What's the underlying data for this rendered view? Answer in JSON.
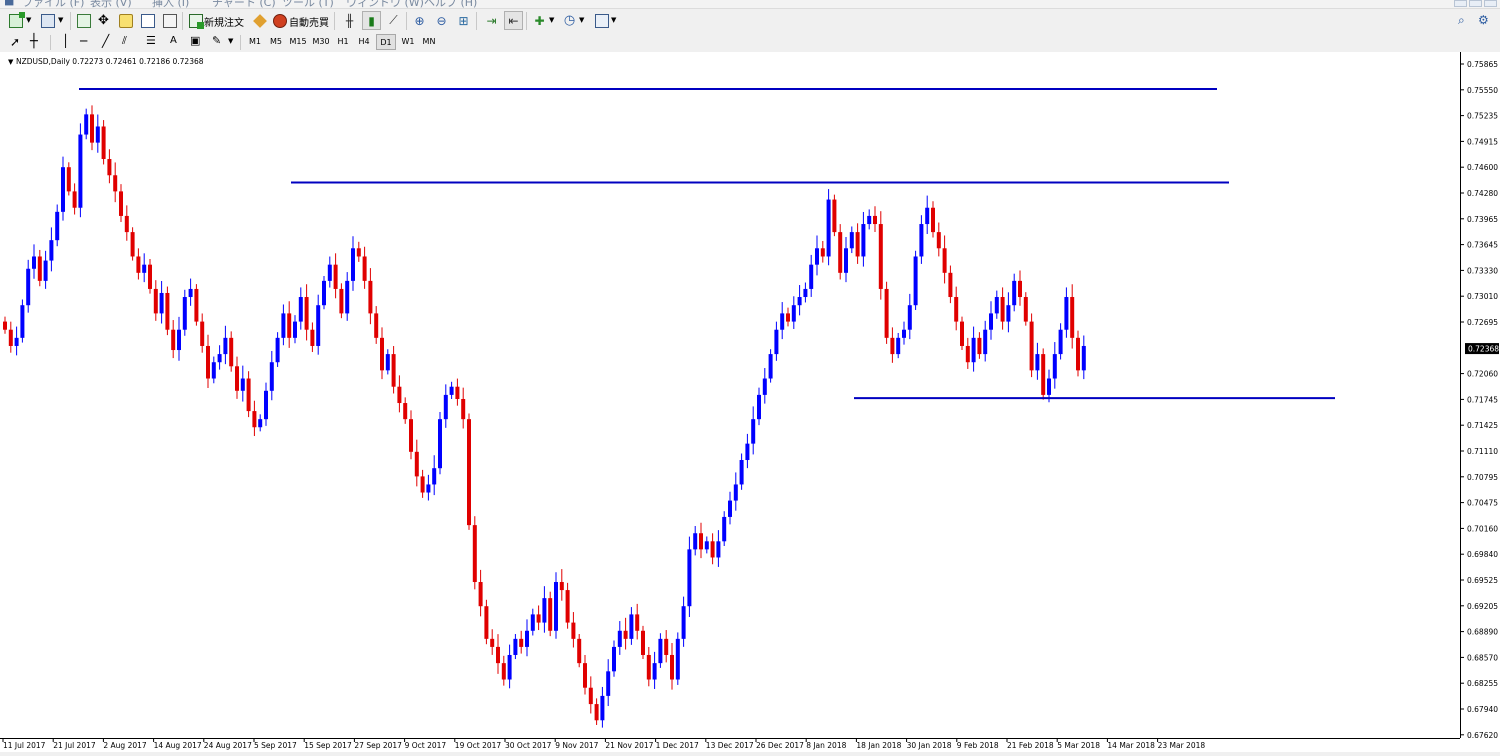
{
  "menu": [
    "ファイル (F)",
    "表示 (V)",
    "挿入 (I)",
    "チャート (C)",
    "ツール (T)",
    "ウィンドウ (W)",
    "ヘルプ (H)"
  ],
  "toolbar": {
    "new_order_label": "新規注文",
    "auto_trading_label": "自動売買"
  },
  "timeframes": [
    "M1",
    "M5",
    "M15",
    "M30",
    "H1",
    "H4",
    "D1",
    "W1",
    "MN"
  ],
  "active_timeframe": "D1",
  "chart": {
    "header": "NZDUSD,Daily  0.72273 0.72461 0.72186 0.72368",
    "current_price_label": "0.72368"
  },
  "colors": {
    "bull": "#0000ff",
    "bear": "#e00000",
    "line": "#0000c0",
    "price_tag": "#000000"
  },
  "chart_data": {
    "type": "candlestick",
    "symbol": "NZDUSD",
    "period": "Daily",
    "ohlc_last": {
      "open": 0.72273,
      "high": 0.72461,
      "low": 0.72186,
      "close": 0.72368
    },
    "y_ticks": [
      "0.75865",
      "0.75550",
      "0.75235",
      "0.74915",
      "0.74600",
      "0.74280",
      "0.73965",
      "0.73645",
      "0.73330",
      "0.73010",
      "0.72695",
      "0.72060",
      "0.71745",
      "0.71425",
      "0.71110",
      "0.70795",
      "0.70475",
      "0.70160",
      "0.69840",
      "0.69525",
      "0.69205",
      "0.68890",
      "0.68570",
      "0.68255",
      "0.67940",
      "0.67620"
    ],
    "x_ticks": [
      "11 Jul 2017",
      "21 Jul 2017",
      "2 Aug 2017",
      "14 Aug 2017",
      "24 Aug 2017",
      "5 Sep 2017",
      "15 Sep 2017",
      "27 Sep 2017",
      "9 Oct 2017",
      "19 Oct 2017",
      "30 Oct 2017",
      "9 Nov 2017",
      "21 Nov 2017",
      "1 Dec 2017",
      "13 Dec 2017",
      "26 Dec 2017",
      "8 Jan 2018",
      "18 Jan 2018",
      "30 Jan 2018",
      "9 Feb 2018",
      "21 Feb 2018",
      "5 Mar 2018",
      "14 Mar 2018",
      "23 Mar 2018"
    ],
    "ylim": [
      0.675,
      0.76
    ],
    "horizontal_lines": [
      {
        "price": 0.7556,
        "from": "21 Jul 2017",
        "to": "late Apr 2018"
      },
      {
        "price": 0.7441,
        "from": "early Sep 2017",
        "to": "late Apr 2018"
      },
      {
        "price": 0.7176,
        "from": "12 Jan 2018",
        "to": "mid May 2018"
      }
    ],
    "closes": [
      0.726,
      0.724,
      0.725,
      0.729,
      0.7335,
      0.735,
      0.732,
      0.7345,
      0.737,
      0.7405,
      0.746,
      0.743,
      0.741,
      0.75,
      0.7525,
      0.749,
      0.751,
      0.747,
      0.745,
      0.743,
      0.74,
      0.738,
      0.735,
      0.733,
      0.734,
      0.731,
      0.728,
      0.7305,
      0.726,
      0.7235,
      0.726,
      0.73,
      0.731,
      0.727,
      0.724,
      0.72,
      0.722,
      0.723,
      0.725,
      0.7215,
      0.7185,
      0.72,
      0.716,
      0.714,
      0.715,
      0.7185,
      0.722,
      0.725,
      0.728,
      0.725,
      0.727,
      0.73,
      0.726,
      0.724,
      0.729,
      0.732,
      0.734,
      0.731,
      0.728,
      0.732,
      0.736,
      0.735,
      0.732,
      0.728,
      0.725,
      0.721,
      0.723,
      0.719,
      0.717,
      0.715,
      0.711,
      0.708,
      0.706,
      0.707,
      0.709,
      0.715,
      0.718,
      0.719,
      0.7175,
      0.715,
      0.702,
      0.695,
      0.692,
      0.688,
      0.687,
      0.685,
      0.683,
      0.686,
      0.688,
      0.687,
      0.689,
      0.691,
      0.69,
      0.693,
      0.689,
      0.695,
      0.694,
      0.69,
      0.688,
      0.685,
      0.682,
      0.68,
      0.678,
      0.681,
      0.684,
      0.687,
      0.689,
      0.688,
      0.691,
      0.689,
      0.686,
      0.683,
      0.685,
      0.688,
      0.686,
      0.683,
      0.688,
      0.692,
      0.699,
      0.701,
      0.699,
      0.7,
      0.698,
      0.7,
      0.703,
      0.705,
      0.707,
      0.71,
      0.712,
      0.715,
      0.718,
      0.72,
      0.723,
      0.726,
      0.728,
      0.727,
      0.729,
      0.73,
      0.731,
      0.734,
      0.736,
      0.735,
      0.742,
      0.738,
      0.733,
      0.736,
      0.738,
      0.735,
      0.739,
      0.74,
      0.739,
      0.731,
      0.725,
      0.723,
      0.725,
      0.726,
      0.729,
      0.735,
      0.739,
      0.741,
      0.738,
      0.736,
      0.733,
      0.73,
      0.727,
      0.724,
      0.722,
      0.725,
      0.723,
      0.726,
      0.728,
      0.73,
      0.727,
      0.729,
      0.732,
      0.73,
      0.727,
      0.721,
      0.723,
      0.718,
      0.72,
      0.723,
      0.726,
      0.73,
      0.725,
      0.721,
      0.724
    ]
  }
}
